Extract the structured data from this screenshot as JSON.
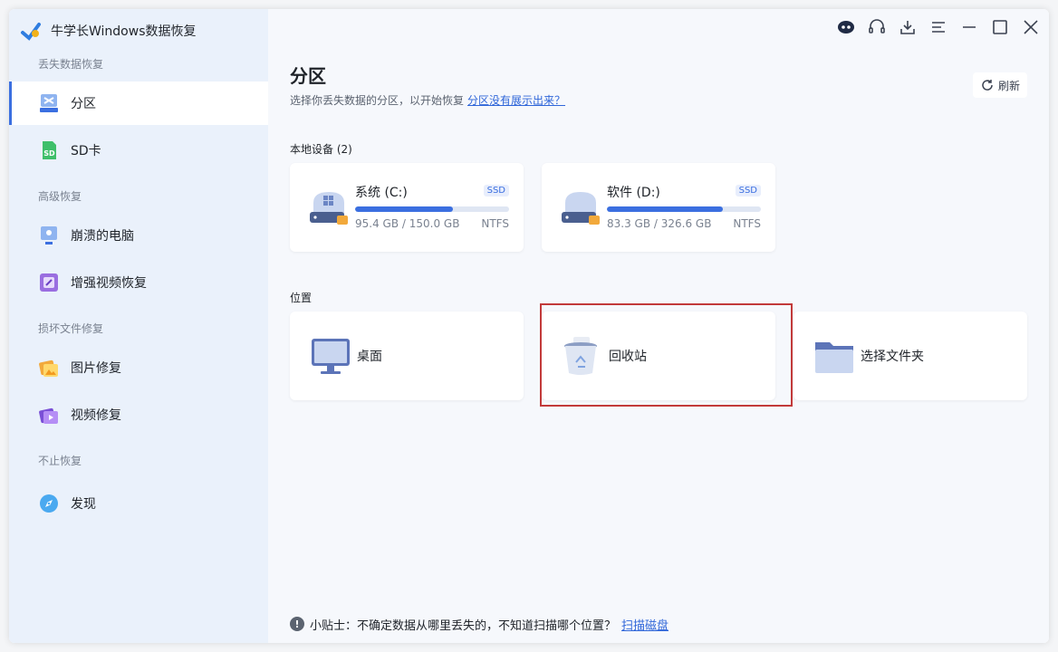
{
  "app": {
    "title": "牛学长Windows数据恢复"
  },
  "sidebar": {
    "sections": [
      {
        "label": "丢失数据恢复"
      },
      {
        "label": "高级恢复"
      },
      {
        "label": "损坏文件修复"
      },
      {
        "label": "不止恢复"
      }
    ],
    "items": [
      {
        "label": "分区",
        "icon": "partition-icon",
        "active": true
      },
      {
        "label": "SD卡",
        "icon": "sd-card-icon"
      },
      {
        "label": "崩溃的电脑",
        "icon": "crashed-pc-icon"
      },
      {
        "label": "增强视频恢复",
        "icon": "video-recovery-icon"
      },
      {
        "label": "图片修复",
        "icon": "photo-repair-icon"
      },
      {
        "label": "视频修复",
        "icon": "video-repair-icon"
      },
      {
        "label": "发现",
        "icon": "discover-icon"
      }
    ]
  },
  "main": {
    "title": "分区",
    "subtitle": "选择你丢失数据的分区，以开始恢复",
    "subtitle_link": "分区没有展示出来？",
    "refresh_label": "刷新",
    "local_devices_label": "本地设备 (2)",
    "locations_label": "位置",
    "drives": [
      {
        "name": "系统 (C:)",
        "badge": "SSD",
        "size": "95.4 GB / 150.0 GB",
        "fs": "NTFS",
        "used_fraction": 0.636
      },
      {
        "name": "软件 (D:)",
        "badge": "SSD",
        "size": "83.3 GB / 326.6 GB",
        "fs": "NTFS",
        "used_fraction": 0.75
      }
    ],
    "locations": [
      {
        "label": "桌面",
        "icon": "desktop-icon"
      },
      {
        "label": "回收站",
        "icon": "recycle-bin-icon",
        "selected": true
      },
      {
        "label": "选择文件夹",
        "icon": "folder-icon"
      }
    ]
  },
  "footer": {
    "tip": "小贴士：不确定数据从哪里丢失的，不知道扫描哪个位置？",
    "link": "扫描磁盘"
  },
  "colors": {
    "accent": "#3b6fe0",
    "selection_border": "#c23a3a",
    "sidebar_bg": "#eaf1fb"
  }
}
